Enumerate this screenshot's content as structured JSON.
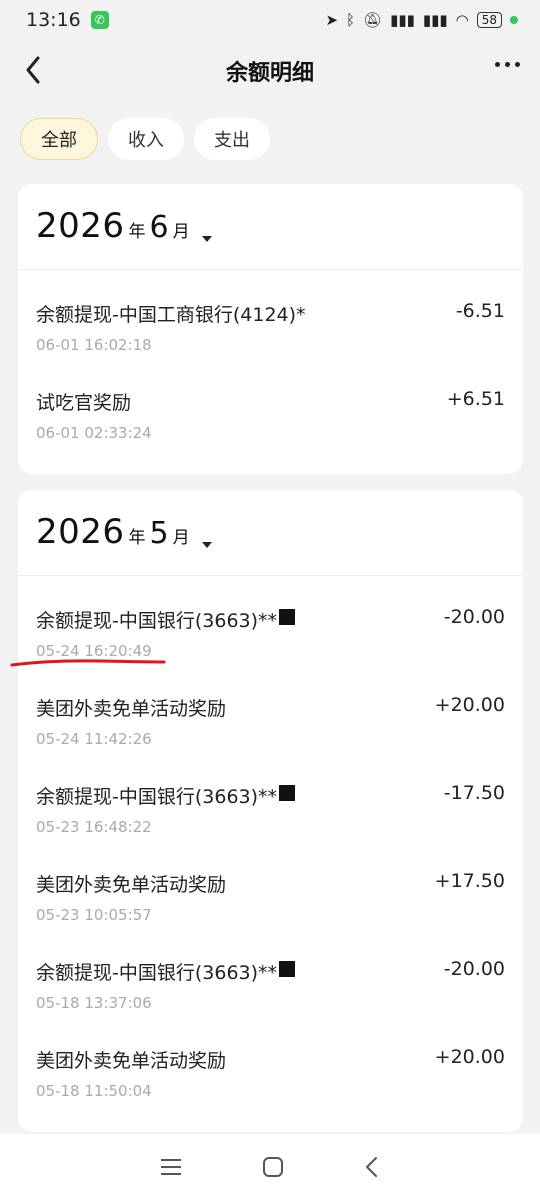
{
  "status": {
    "time": "13:16",
    "battery": "58"
  },
  "header": {
    "title": "余额明细"
  },
  "filters": [
    {
      "label": "全部"
    },
    {
      "label": "收入"
    },
    {
      "label": "支出"
    }
  ],
  "months": [
    {
      "year": "2026",
      "year_unit": "年",
      "month": "6",
      "month_unit": "月",
      "items": [
        {
          "title": "余额提现-中国工商银行(4124)*",
          "time": "06-01 16:02:18",
          "amount": "-6.51"
        },
        {
          "title": "试吃官奖励",
          "time": "06-01 02:33:24",
          "amount": "+6.51"
        }
      ]
    },
    {
      "year": "2026",
      "year_unit": "年",
      "month": "5",
      "month_unit": "月",
      "items": [
        {
          "title": "余额提现-中国银行(3663)**",
          "time": "05-24 16:20:49",
          "amount": "-20.00"
        },
        {
          "title": "美团外卖免单活动奖励",
          "time": "05-24 11:42:26",
          "amount": "+20.00"
        },
        {
          "title": "余额提现-中国银行(3663)**",
          "time": "05-23 16:48:22",
          "amount": "-17.50"
        },
        {
          "title": "美团外卖免单活动奖励",
          "time": "05-23 10:05:57",
          "amount": "+17.50"
        },
        {
          "title": "余额提现-中国银行(3663)**",
          "time": "05-18 13:37:06",
          "amount": "-20.00"
        },
        {
          "title": "美团外卖免单活动奖励",
          "time": "05-18 11:50:04",
          "amount": "+20.00"
        }
      ]
    }
  ]
}
